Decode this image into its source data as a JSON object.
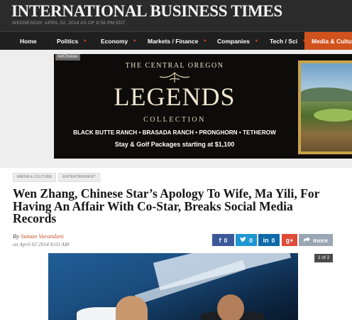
{
  "header": {
    "site_title": "INTERNATIONAL BUSINESS TIMES",
    "date_line": "WEDNESDAY, APRIL 02, 2014 AS OF 8:56 PM EDT"
  },
  "nav": {
    "items": [
      {
        "label": "Home",
        "has_dropdown": false
      },
      {
        "label": "Politics",
        "has_dropdown": true
      },
      {
        "label": "Economy",
        "has_dropdown": true
      },
      {
        "label": "Markets / Finance",
        "has_dropdown": true
      },
      {
        "label": "Companies",
        "has_dropdown": true
      },
      {
        "label": "Tech / Sci",
        "has_dropdown": true
      },
      {
        "label": "Media & Culture",
        "has_dropdown": false,
        "active": true
      }
    ],
    "dropdown_glyph": "▾"
  },
  "ad": {
    "adchoices": "AdChoices",
    "top_line": "THE CENTRAL OREGON",
    "headline": "LEGENDS",
    "subline": "COLLECTION",
    "ranches": "BLACK BUTTE RANCH • BRASADA RANCH • PRONGHORN • TETHEROW",
    "offer": "Stay & Golf Packages starting at $1,100"
  },
  "article": {
    "tags": [
      "MEDIA & CULTURE",
      "ENTERTAINMENT"
    ],
    "headline": "Wen Zhang, Chinese Star’s Apology To Wife, Ma Yili, For Having An Affair With Co-Star, Breaks Social Media Records",
    "byline_prefix": "By",
    "author": "Suman Varandani",
    "published": "on April 02 2014 8:03 AM",
    "photo_counter": "1 of 2"
  },
  "share": {
    "facebook": {
      "icon": "f",
      "count": "0"
    },
    "twitter": {
      "icon": "twitter-bird",
      "count": "0"
    },
    "linkedin": {
      "icon": "in",
      "count": "0"
    },
    "googleplus": {
      "icon": "g+"
    },
    "more": {
      "icon": "share-arrow",
      "label": "more"
    }
  },
  "colors": {
    "masthead": "#2b2b2b",
    "nav_active": "#d0521d",
    "author_link": "#c8502a",
    "facebook": "#3b5998",
    "twitter": "#1e97d4",
    "linkedin": "#0f6aa8",
    "googleplus": "#dd4b39",
    "more": "#9aa6b3"
  }
}
